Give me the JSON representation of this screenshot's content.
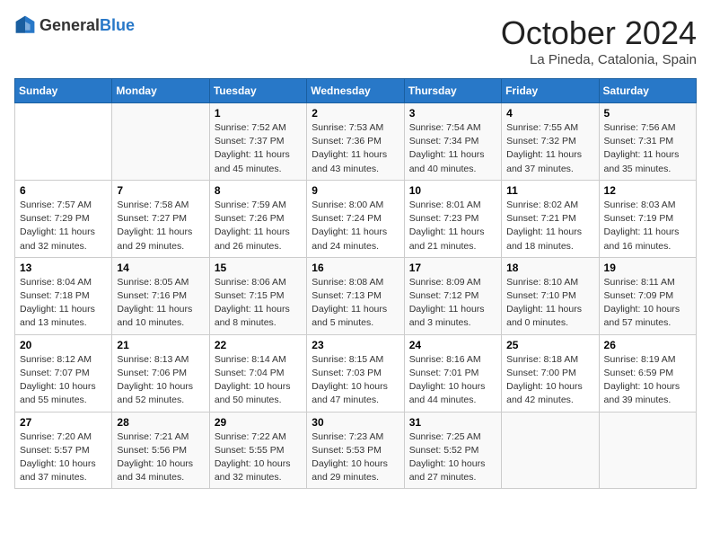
{
  "header": {
    "logo_general": "General",
    "logo_blue": "Blue",
    "month_title": "October 2024",
    "location": "La Pineda, Catalonia, Spain"
  },
  "weekdays": [
    "Sunday",
    "Monday",
    "Tuesday",
    "Wednesday",
    "Thursday",
    "Friday",
    "Saturday"
  ],
  "weeks": [
    [
      {
        "day": "",
        "content": ""
      },
      {
        "day": "",
        "content": ""
      },
      {
        "day": "1",
        "content": "Sunrise: 7:52 AM\nSunset: 7:37 PM\nDaylight: 11 hours and 45 minutes."
      },
      {
        "day": "2",
        "content": "Sunrise: 7:53 AM\nSunset: 7:36 PM\nDaylight: 11 hours and 43 minutes."
      },
      {
        "day": "3",
        "content": "Sunrise: 7:54 AM\nSunset: 7:34 PM\nDaylight: 11 hours and 40 minutes."
      },
      {
        "day": "4",
        "content": "Sunrise: 7:55 AM\nSunset: 7:32 PM\nDaylight: 11 hours and 37 minutes."
      },
      {
        "day": "5",
        "content": "Sunrise: 7:56 AM\nSunset: 7:31 PM\nDaylight: 11 hours and 35 minutes."
      }
    ],
    [
      {
        "day": "6",
        "content": "Sunrise: 7:57 AM\nSunset: 7:29 PM\nDaylight: 11 hours and 32 minutes."
      },
      {
        "day": "7",
        "content": "Sunrise: 7:58 AM\nSunset: 7:27 PM\nDaylight: 11 hours and 29 minutes."
      },
      {
        "day": "8",
        "content": "Sunrise: 7:59 AM\nSunset: 7:26 PM\nDaylight: 11 hours and 26 minutes."
      },
      {
        "day": "9",
        "content": "Sunrise: 8:00 AM\nSunset: 7:24 PM\nDaylight: 11 hours and 24 minutes."
      },
      {
        "day": "10",
        "content": "Sunrise: 8:01 AM\nSunset: 7:23 PM\nDaylight: 11 hours and 21 minutes."
      },
      {
        "day": "11",
        "content": "Sunrise: 8:02 AM\nSunset: 7:21 PM\nDaylight: 11 hours and 18 minutes."
      },
      {
        "day": "12",
        "content": "Sunrise: 8:03 AM\nSunset: 7:19 PM\nDaylight: 11 hours and 16 minutes."
      }
    ],
    [
      {
        "day": "13",
        "content": "Sunrise: 8:04 AM\nSunset: 7:18 PM\nDaylight: 11 hours and 13 minutes."
      },
      {
        "day": "14",
        "content": "Sunrise: 8:05 AM\nSunset: 7:16 PM\nDaylight: 11 hours and 10 minutes."
      },
      {
        "day": "15",
        "content": "Sunrise: 8:06 AM\nSunset: 7:15 PM\nDaylight: 11 hours and 8 minutes."
      },
      {
        "day": "16",
        "content": "Sunrise: 8:08 AM\nSunset: 7:13 PM\nDaylight: 11 hours and 5 minutes."
      },
      {
        "day": "17",
        "content": "Sunrise: 8:09 AM\nSunset: 7:12 PM\nDaylight: 11 hours and 3 minutes."
      },
      {
        "day": "18",
        "content": "Sunrise: 8:10 AM\nSunset: 7:10 PM\nDaylight: 11 hours and 0 minutes."
      },
      {
        "day": "19",
        "content": "Sunrise: 8:11 AM\nSunset: 7:09 PM\nDaylight: 10 hours and 57 minutes."
      }
    ],
    [
      {
        "day": "20",
        "content": "Sunrise: 8:12 AM\nSunset: 7:07 PM\nDaylight: 10 hours and 55 minutes."
      },
      {
        "day": "21",
        "content": "Sunrise: 8:13 AM\nSunset: 7:06 PM\nDaylight: 10 hours and 52 minutes."
      },
      {
        "day": "22",
        "content": "Sunrise: 8:14 AM\nSunset: 7:04 PM\nDaylight: 10 hours and 50 minutes."
      },
      {
        "day": "23",
        "content": "Sunrise: 8:15 AM\nSunset: 7:03 PM\nDaylight: 10 hours and 47 minutes."
      },
      {
        "day": "24",
        "content": "Sunrise: 8:16 AM\nSunset: 7:01 PM\nDaylight: 10 hours and 44 minutes."
      },
      {
        "day": "25",
        "content": "Sunrise: 8:18 AM\nSunset: 7:00 PM\nDaylight: 10 hours and 42 minutes."
      },
      {
        "day": "26",
        "content": "Sunrise: 8:19 AM\nSunset: 6:59 PM\nDaylight: 10 hours and 39 minutes."
      }
    ],
    [
      {
        "day": "27",
        "content": "Sunrise: 7:20 AM\nSunset: 5:57 PM\nDaylight: 10 hours and 37 minutes."
      },
      {
        "day": "28",
        "content": "Sunrise: 7:21 AM\nSunset: 5:56 PM\nDaylight: 10 hours and 34 minutes."
      },
      {
        "day": "29",
        "content": "Sunrise: 7:22 AM\nSunset: 5:55 PM\nDaylight: 10 hours and 32 minutes."
      },
      {
        "day": "30",
        "content": "Sunrise: 7:23 AM\nSunset: 5:53 PM\nDaylight: 10 hours and 29 minutes."
      },
      {
        "day": "31",
        "content": "Sunrise: 7:25 AM\nSunset: 5:52 PM\nDaylight: 10 hours and 27 minutes."
      },
      {
        "day": "",
        "content": ""
      },
      {
        "day": "",
        "content": ""
      }
    ]
  ]
}
